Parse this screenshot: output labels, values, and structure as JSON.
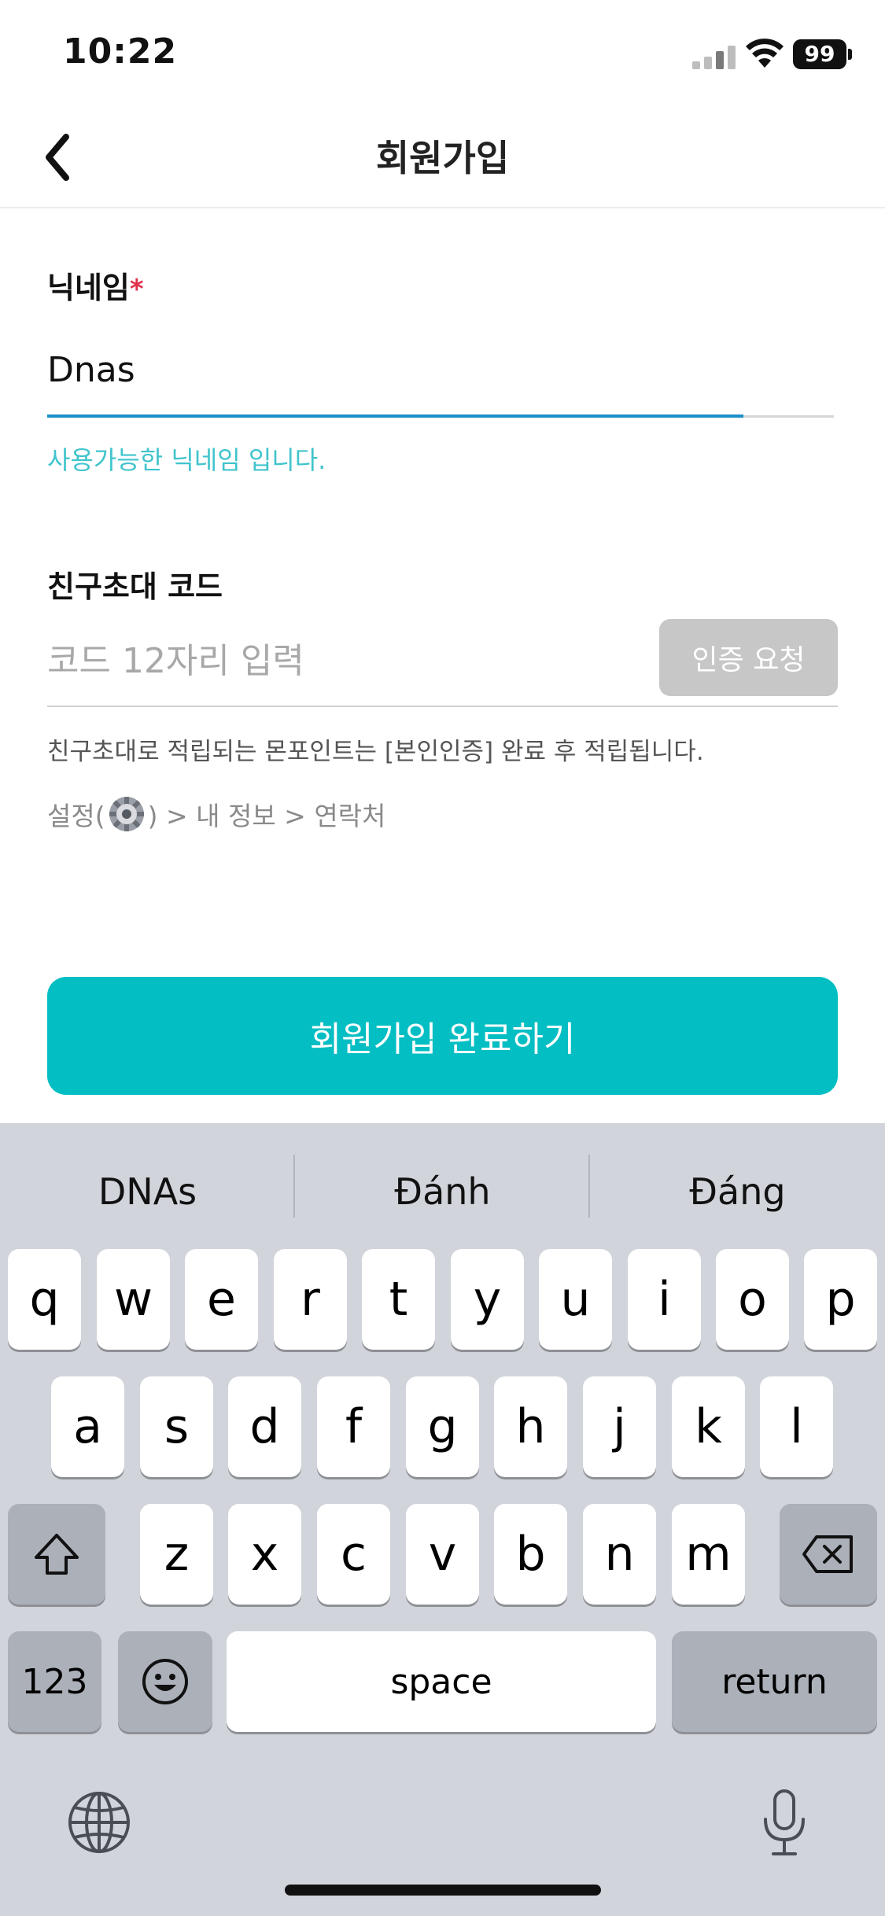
{
  "status_bar": {
    "time": "10:22",
    "battery": "99"
  },
  "nav": {
    "title": "회원가입"
  },
  "nickname": {
    "label": "닉네임",
    "required_mark": "*",
    "value": "Dnas",
    "hint": "사용가능한 닉네임 입니다."
  },
  "invite": {
    "label": "친구초대 코드",
    "placeholder": "코드 12자리 입력",
    "verify_button": "인증 요청",
    "note": "친구초대로 적립되는 몬포인트는 [본인인증] 완료 후 적립됩니다.",
    "path_prefix": "설정(",
    "path_suffix": ") > 내 정보 > 연락처"
  },
  "submit_button": "회원가입 완료하기",
  "keyboard": {
    "suggestions": [
      "DNAs",
      "Đánh",
      "Đáng"
    ],
    "row1": [
      "q",
      "w",
      "e",
      "r",
      "t",
      "y",
      "u",
      "i",
      "o",
      "p"
    ],
    "row2": [
      "a",
      "s",
      "d",
      "f",
      "g",
      "h",
      "j",
      "k",
      "l"
    ],
    "row3": [
      "z",
      "x",
      "c",
      "v",
      "b",
      "n",
      "m"
    ],
    "numbers_key": "123",
    "space_key": "space",
    "return_key": "return"
  },
  "colors": {
    "accent": "#03bec3",
    "hint": "#40c4cc",
    "required": "#e0314b",
    "active_underline": "#1a8fc9"
  }
}
